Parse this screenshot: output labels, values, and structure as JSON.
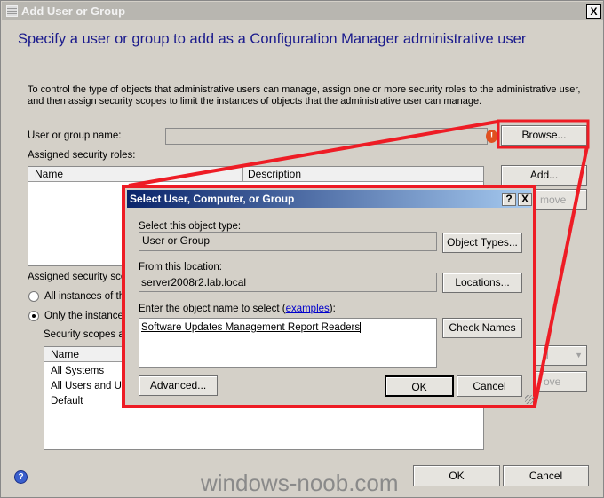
{
  "window": {
    "title": "Add User or Group",
    "close": "X"
  },
  "heading": "Specify a user or group to add as a Configuration Manager administrative user",
  "description": "To control the type of objects that administrative users can manage, assign one or more security roles  to the  administrative user, and then assign security scopes to limit the instances of objects that the administrative user can manage.",
  "user_label": "User or group name:",
  "user_value": "",
  "browse": "Browse...",
  "roles_label": "Assigned security roles:",
  "roles_columns": [
    "Name",
    "Description"
  ],
  "add": "Add...",
  "remove_roles": "move",
  "scopes_label": "Assigned security scop",
  "radio_all": "All instances of the",
  "radio_only": "Only the instances",
  "scopes_sub": "Security scopes an",
  "scopes_column": "Name",
  "scopes": [
    "All Systems",
    "All Users and Use",
    "Default"
  ],
  "scope_dropdown": "d",
  "remove_scopes": "ove",
  "ok": "OK",
  "cancel": "Cancel",
  "watermark": "windows-noob.com",
  "highlight_color": "#ee1c25",
  "dialog": {
    "title": "Select User, Computer, or Group",
    "help": "?",
    "close": "X",
    "type_label": "Select this object type:",
    "type_value": "User or Group",
    "object_types": "Object Types...",
    "location_label": "From this location:",
    "location_value": "server2008r2.lab.local",
    "locations": "Locations...",
    "name_label_pre": "Enter the object name to select (",
    "name_link": "examples",
    "name_label_post": "):",
    "name_value": "Software Updates Management Report Readers",
    "check_names": "Check Names",
    "advanced": "Advanced...",
    "ok": "OK",
    "cancel": "Cancel"
  }
}
